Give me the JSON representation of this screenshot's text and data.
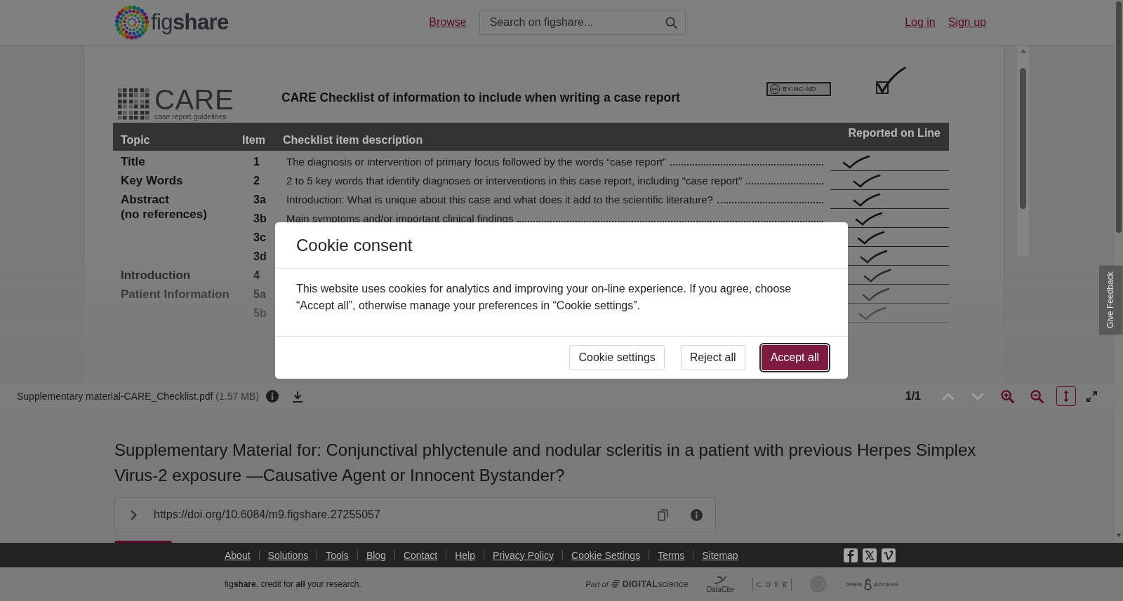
{
  "header": {
    "logo": "fig**share**",
    "nav": [
      {
        "label": "Browse"
      }
    ],
    "search": {
      "placeholder": "Search on figshare..."
    },
    "account_links": [
      {
        "label": "Log in"
      },
      {
        "label": "Sign up"
      }
    ]
  },
  "viewer": {
    "document": {
      "logo": {
        "name": "CARE",
        "tagline": "case report guidelines"
      },
      "heading": "CARE Checklist of information to include when writing a case report",
      "license": {
        "mark": "cc",
        "label": "BY-NC-ND"
      },
      "columns": [
        "Topic",
        "Item",
        "Checklist item description",
        "Reported on Line"
      ],
      "rows": [
        {
          "topic": "Title",
          "item": "1",
          "description": "The diagnosis or intervention of primary focus followed by the words “case report”",
          "checked": true
        },
        {
          "topic": "Key Words",
          "item": "2",
          "description": "2 to 5 key words that identify diagnoses or interventions in this case report, including \"case report\"",
          "checked": true
        },
        {
          "topic": "Abstract\n(no references)",
          "item": "3a",
          "description": "Introduction: What is unique about this case and what does it add to the scientific literature?",
          "checked": true
        },
        {
          "item": "3b",
          "description": "Main symptoms and/or important clinical findings",
          "checked": true
        },
        {
          "item": "3c",
          "checked": true
        },
        {
          "item": "3d",
          "checked": true
        },
        {
          "topic": "Introduction",
          "item": "4",
          "checked": true
        },
        {
          "topic": "Patient Information",
          "item": "5a",
          "checked": true
        },
        {
          "item": "5b",
          "checked": true
        }
      ]
    }
  },
  "file_bar": {
    "file_name": "Supplementary material-CARE_Checklist.pdf",
    "file_size": "(1.57 MB)",
    "page_indicator": "1/1",
    "tools": [
      {
        "kind": "previous",
        "disabled": true,
        "selected": false
      },
      {
        "kind": "next",
        "disabled": true,
        "selected": false
      },
      {
        "kind": "zoom_in",
        "disabled": false,
        "selected": false
      },
      {
        "kind": "zoom_out",
        "disabled": false,
        "selected": false
      },
      {
        "kind": "fit_height",
        "disabled": false,
        "selected": true
      },
      {
        "kind": "fullscreen",
        "disabled": false,
        "selected": false
      }
    ]
  },
  "item": {
    "title": "Supplementary Material for: Conjunctival phlyctenule and nodular scleritis in a patient with previous Herpes Simplex Virus-2 exposure —Causative Agent or Innocent Bystander?",
    "doi": {
      "url": "https://doi.org/10.6084/m9.figshare.27255057",
      "expanded": false
    }
  },
  "footer": {
    "links": [
      {
        "label": "About"
      },
      {
        "label": "Solutions"
      },
      {
        "label": "Tools"
      },
      {
        "label": "Blog"
      },
      {
        "label": "Contact"
      },
      {
        "label": "Help"
      },
      {
        "label": "Privacy Policy"
      },
      {
        "label": "Cookie Settings"
      },
      {
        "label": "Terms"
      },
      {
        "label": "Sitemap"
      }
    ],
    "social": [
      {
        "kind": "facebook"
      },
      {
        "kind": "x"
      },
      {
        "kind": "vimeo"
      }
    ],
    "tagline": "fig**share**. credit for **all** your research.",
    "partners": [
      {
        "kind": "digital_science",
        "prefix": "Part of",
        "label": "**DIGITAL**science"
      },
      {
        "kind": "datacite",
        "label": "DataCite"
      },
      {
        "kind": "cope",
        "label": "COPE"
      },
      {
        "kind": "seal"
      },
      {
        "kind": "open_access",
        "label": "OPEN",
        "suffix": "ACCESS"
      }
    ]
  },
  "feedback_tab": {
    "label": "Give Feedback"
  },
  "cookie_modal": {
    "title": "Cookie consent",
    "body": "This website uses cookies for analytics and improving your on-line experience. If you agree, choose “Accept all”, otherwise manage your preferences in “Cookie settings”.",
    "buttons": [
      {
        "label": "Cookie settings",
        "kind": "secondary",
        "focused": false
      },
      {
        "label": "Reject all",
        "kind": "secondary",
        "focused": false
      },
      {
        "label": "Accept all",
        "kind": "primary",
        "focused": true
      }
    ]
  }
}
